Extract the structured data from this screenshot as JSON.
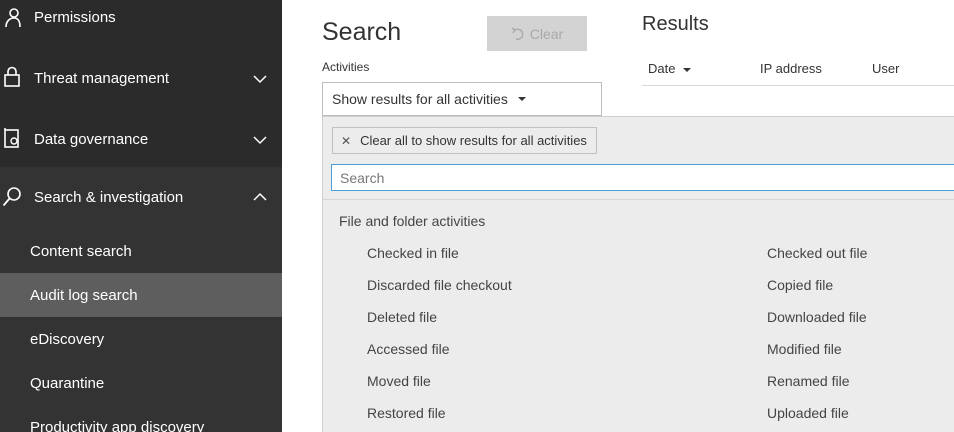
{
  "sidebar": {
    "nav_items": [
      {
        "label": "Permissions",
        "icon": "permissions-icon"
      },
      {
        "label": "Threat management",
        "icon": "lock-icon"
      },
      {
        "label": "Data governance",
        "icon": "data-governance-icon"
      },
      {
        "label": "Search & investigation",
        "icon": "search-icon"
      }
    ],
    "sub_items": [
      {
        "label": "Content search"
      },
      {
        "label": "Audit log search",
        "active": true
      },
      {
        "label": "eDiscovery"
      },
      {
        "label": "Quarantine"
      },
      {
        "label": "Productivity app discovery"
      }
    ]
  },
  "search": {
    "title": "Search",
    "clear_label": "Clear",
    "activities_label": "Activities",
    "activities_value": "Show results for all activities"
  },
  "results": {
    "title": "Results",
    "columns": [
      "Date",
      "IP address",
      "User"
    ]
  },
  "panel": {
    "chip_label": "Clear all to show results for all activities",
    "search_placeholder": "Search",
    "group_label": "File and folder activities",
    "activities_left": [
      "Checked in file",
      "Discarded file checkout",
      "Deleted file",
      "Accessed file",
      "Moved file",
      "Restored file"
    ],
    "activities_right": [
      "Checked out file",
      "Copied file",
      "Downloaded file",
      "Modified file",
      "Renamed file",
      "Uploaded file"
    ]
  },
  "colors": {
    "sidebar_bg": "#2b2b2b",
    "sidebar_active": "#5e5e5e",
    "focus_border": "#4a9fd8"
  }
}
